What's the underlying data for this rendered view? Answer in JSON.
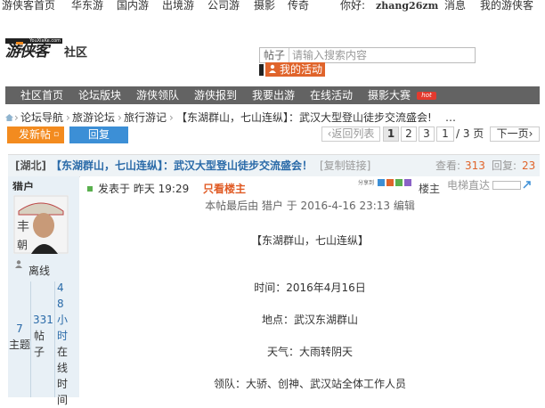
{
  "topnav": {
    "items": [
      "游侠客首页",
      "华东游",
      "国内游",
      "出境游",
      "公司游",
      "摄影",
      "传奇"
    ],
    "greeting": "你好:",
    "username": "zhang26zm",
    "messages": "消息",
    "my_account": "我的游侠客"
  },
  "logo": {
    "brand_small": "YouXiaKe.com",
    "brand": "游侠客",
    "section": "社区"
  },
  "search": {
    "scope": "帖子",
    "placeholder": "请输入搜索内容"
  },
  "my_activity": "我的活动",
  "mainnav": {
    "items": [
      "社区首页",
      "论坛版块",
      "游侠领队",
      "游侠报到",
      "我要出游",
      "在线活动",
      "摄影大赛"
    ],
    "hot_badge": "hot"
  },
  "breadcrumb": {
    "items": [
      "论坛导航",
      "旅游论坛",
      "旅行游记"
    ],
    "current": "【东湖群山，七山连纵】：武汉大型登山徒步交流盛会!",
    "ellipsis": "…"
  },
  "actions": {
    "post": "发新帖",
    "reply": "回复"
  },
  "pager": {
    "back": "返回列表",
    "pages": [
      "1",
      "2",
      "3"
    ],
    "current_input": "1",
    "total": "/ 3 页",
    "next": "下一页"
  },
  "thread": {
    "region": "[湖北]",
    "title": "【东湖群山，七山连纵】：武汉大型登山徒步交流盛会！",
    "copy_link": "[复制链接]",
    "views_label": "查看:",
    "views": "313",
    "replies_label": "回复:",
    "replies": "23"
  },
  "author": {
    "name": "猎户",
    "status": "离线",
    "stats": [
      {
        "value": "7",
        "label": "主题"
      },
      {
        "value": "331",
        "label": "帖子"
      },
      {
        "value": "48小时",
        "label": "在线时间"
      }
    ]
  },
  "post": {
    "posted_at": "发表于 昨天 19:29",
    "only_author": "只看楼主",
    "share": "分享到",
    "floor": "楼主",
    "elevator": "电梯直达",
    "edit_note": "本帖最后由 猎户 于 2016-4-16 23:13 编辑",
    "lines": [
      "【东湖群山，七山连纵】",
      "时间：2016年4月16日",
      "地点：武汉东湖群山",
      "天气：大雨转阴天",
      "领队：大骄、创神、武汉站全体工作人员"
    ]
  },
  "colors": {
    "nav_bar": "#636363",
    "accent_orange": "#f38b1f",
    "reply_blue": "#3c8fd6",
    "title_red": "#d9534f",
    "title_blue": "#2a6aa8"
  }
}
